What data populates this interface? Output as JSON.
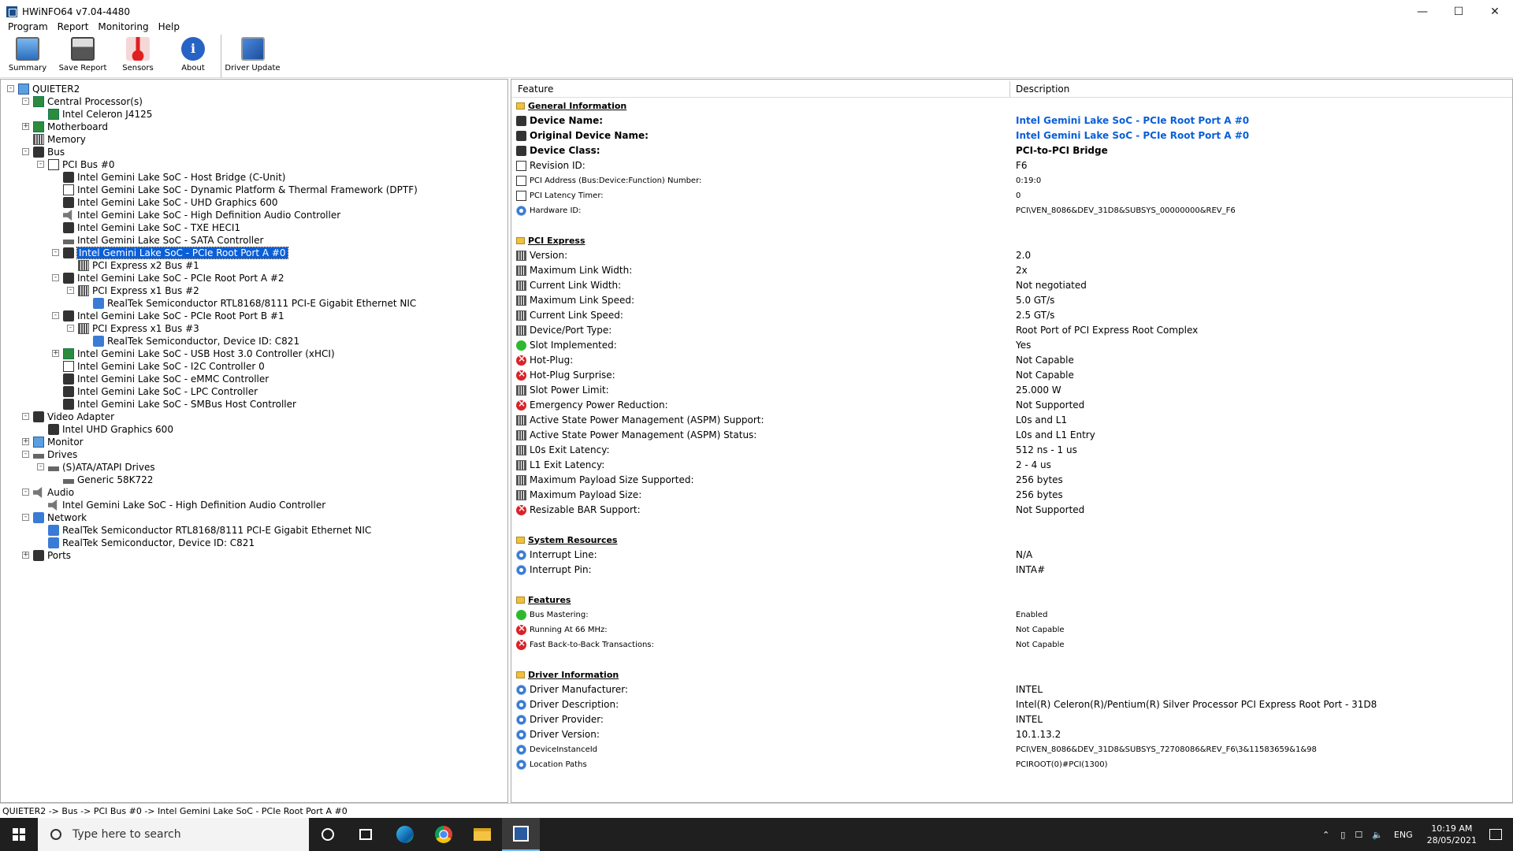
{
  "window": {
    "title": "HWiNFO64 v7.04-4480"
  },
  "menu": [
    "Program",
    "Report",
    "Monitoring",
    "Help"
  ],
  "toolbar": [
    {
      "label": "Summary",
      "icon": "monitor-icon"
    },
    {
      "label": "Save Report",
      "icon": "floppy-icon"
    },
    {
      "label": "Sensors",
      "icon": "thermometer-icon"
    },
    {
      "label": "About",
      "icon": "info-icon"
    },
    {
      "label": "Driver Update",
      "icon": "driver-update-icon"
    }
  ],
  "tree": [
    {
      "label": "QUIETER2",
      "level": 0,
      "exp": "-",
      "icon": "computer"
    },
    {
      "label": "Central Processor(s)",
      "level": 1,
      "exp": "-",
      "icon": "green"
    },
    {
      "label": "Intel Celeron J4125",
      "level": 2,
      "exp": "",
      "icon": "green"
    },
    {
      "label": "Motherboard",
      "level": 1,
      "exp": "+",
      "icon": "green"
    },
    {
      "label": "Memory",
      "level": 1,
      "exp": "",
      "icon": "grid"
    },
    {
      "label": "Bus",
      "level": 1,
      "exp": "-",
      "icon": "bus"
    },
    {
      "label": "PCI Bus #0",
      "level": 2,
      "exp": "-",
      "icon": "pci"
    },
    {
      "label": "Intel Gemini Lake SoC - Host Bridge (C-Unit)",
      "level": 3,
      "exp": "",
      "icon": "chip"
    },
    {
      "label": "Intel Gemini Lake SoC - Dynamic Platform & Thermal Framework (DPTF)",
      "level": 3,
      "exp": "",
      "icon": "pci"
    },
    {
      "label": "Intel Gemini Lake SoC - UHD Graphics 600",
      "level": 3,
      "exp": "",
      "icon": "gpu"
    },
    {
      "label": "Intel Gemini Lake SoC - High Definition Audio Controller",
      "level": 3,
      "exp": "",
      "icon": "speaker"
    },
    {
      "label": "Intel Gemini Lake SoC - TXE HECI1",
      "level": 3,
      "exp": "",
      "icon": "chip"
    },
    {
      "label": "Intel Gemini Lake SoC - SATA Controller",
      "level": 3,
      "exp": "",
      "icon": "drive"
    },
    {
      "label": "Intel Gemini Lake SoC - PCIe Root Port A #0",
      "level": 3,
      "exp": "-",
      "icon": "chip",
      "selected": true
    },
    {
      "label": "PCI Express x2 Bus #1",
      "level": 4,
      "exp": "",
      "icon": "grid"
    },
    {
      "label": "Intel Gemini Lake SoC - PCIe Root Port A #2",
      "level": 3,
      "exp": "-",
      "icon": "chip"
    },
    {
      "label": "PCI Express x1 Bus #2",
      "level": 4,
      "exp": "-",
      "icon": "grid"
    },
    {
      "label": "RealTek Semiconductor RTL8168/8111 PCI-E Gigabit Ethernet NIC",
      "level": 5,
      "exp": "",
      "icon": "net"
    },
    {
      "label": "Intel Gemini Lake SoC - PCIe Root Port B #1",
      "level": 3,
      "exp": "-",
      "icon": "chip"
    },
    {
      "label": "PCI Express x1 Bus #3",
      "level": 4,
      "exp": "-",
      "icon": "grid"
    },
    {
      "label": "RealTek Semiconductor, Device ID: C821",
      "level": 5,
      "exp": "",
      "icon": "net"
    },
    {
      "label": "Intel Gemini Lake SoC - USB Host 3.0 Controller (xHCI)",
      "level": 3,
      "exp": "+",
      "icon": "usb"
    },
    {
      "label": "Intel Gemini Lake SoC - I2C Controller 0",
      "level": 3,
      "exp": "",
      "icon": "pci"
    },
    {
      "label": "Intel Gemini Lake SoC - eMMC Controller",
      "level": 3,
      "exp": "",
      "icon": "chip"
    },
    {
      "label": "Intel Gemini Lake SoC - LPC Controller",
      "level": 3,
      "exp": "",
      "icon": "chip"
    },
    {
      "label": "Intel Gemini Lake SoC - SMBus Host Controller",
      "level": 3,
      "exp": "",
      "icon": "bus"
    },
    {
      "label": "Video Adapter",
      "level": 1,
      "exp": "-",
      "icon": "gpu"
    },
    {
      "label": "Intel UHD Graphics 600",
      "level": 2,
      "exp": "",
      "icon": "gpu"
    },
    {
      "label": "Monitor",
      "level": 1,
      "exp": "+",
      "icon": "monitor"
    },
    {
      "label": "Drives",
      "level": 1,
      "exp": "-",
      "icon": "drive"
    },
    {
      "label": "(S)ATA/ATAPI Drives",
      "level": 2,
      "exp": "-",
      "icon": "drive"
    },
    {
      "label": "Generic 58K722",
      "level": 3,
      "exp": "",
      "icon": "drive"
    },
    {
      "label": "Audio",
      "level": 1,
      "exp": "-",
      "icon": "speaker"
    },
    {
      "label": "Intel Gemini Lake SoC - High Definition Audio Controller",
      "level": 2,
      "exp": "",
      "icon": "speaker"
    },
    {
      "label": "Network",
      "level": 1,
      "exp": "-",
      "icon": "net"
    },
    {
      "label": "RealTek Semiconductor RTL8168/8111 PCI-E Gigabit Ethernet NIC",
      "level": 2,
      "exp": "",
      "icon": "net"
    },
    {
      "label": "RealTek Semiconductor, Device ID: C821",
      "level": 2,
      "exp": "",
      "icon": "net"
    },
    {
      "label": "Ports",
      "level": 1,
      "exp": "+",
      "icon": "port"
    }
  ],
  "details": {
    "headers": {
      "feature": "Feature",
      "description": "Description"
    },
    "rows": [
      {
        "type": "section",
        "feature": "General Information"
      },
      {
        "icon": "chip",
        "feature": "Device Name:",
        "value": "Intel Gemini Lake SoC - PCIe Root Port A #0",
        "fstyle": "bold",
        "vstyle": "blue"
      },
      {
        "icon": "chip",
        "feature": "Original Device Name:",
        "value": "Intel Gemini Lake SoC - PCIe Root Port A #0",
        "fstyle": "bold",
        "vstyle": "blue"
      },
      {
        "icon": "chip",
        "feature": "Device Class:",
        "value": "PCI-to-PCI Bridge",
        "fstyle": "bold",
        "vstyle": "bold"
      },
      {
        "icon": "pci",
        "feature": "Revision ID:",
        "value": "F6"
      },
      {
        "icon": "pci",
        "feature": "PCI Address (Bus:Device:Function) Number:",
        "value": "0:19:0",
        "fstyle": "small",
        "vstyle": "small"
      },
      {
        "icon": "pci",
        "feature": "PCI Latency Timer:",
        "value": "0",
        "fstyle": "small",
        "vstyle": "small"
      },
      {
        "icon": "gear",
        "feature": "Hardware ID:",
        "value": "PCI\\VEN_8086&DEV_31D8&SUBSYS_00000000&REV_F6",
        "fstyle": "small",
        "vstyle": "small"
      },
      {
        "type": "blank"
      },
      {
        "type": "section",
        "feature": "PCI Express"
      },
      {
        "icon": "grid",
        "feature": "Version:",
        "value": "2.0"
      },
      {
        "icon": "grid",
        "feature": "Maximum Link Width:",
        "value": "2x"
      },
      {
        "icon": "grid",
        "feature": "Current Link Width:",
        "value": "Not negotiated"
      },
      {
        "icon": "grid",
        "feature": "Maximum Link Speed:",
        "value": "5.0 GT/s"
      },
      {
        "icon": "grid",
        "feature": "Current Link Speed:",
        "value": "2.5 GT/s"
      },
      {
        "icon": "grid",
        "feature": "Device/Port Type:",
        "value": "Root Port of PCI Express Root Complex"
      },
      {
        "icon": "ok",
        "feature": "Slot Implemented:",
        "value": "Yes"
      },
      {
        "icon": "no",
        "feature": "Hot-Plug:",
        "value": "Not Capable"
      },
      {
        "icon": "no",
        "feature": "Hot-Plug Surprise:",
        "value": "Not Capable"
      },
      {
        "icon": "grid",
        "feature": "Slot Power Limit:",
        "value": "25.000 W"
      },
      {
        "icon": "no",
        "feature": "Emergency Power Reduction:",
        "value": "Not Supported"
      },
      {
        "icon": "grid",
        "feature": "Active State Power Management (ASPM) Support:",
        "value": "L0s and L1"
      },
      {
        "icon": "grid",
        "feature": "Active State Power Management (ASPM) Status:",
        "value": "L0s and L1 Entry"
      },
      {
        "icon": "grid",
        "feature": "L0s Exit Latency:",
        "value": "512 ns - 1 us"
      },
      {
        "icon": "grid",
        "feature": "L1 Exit Latency:",
        "value": "2 - 4 us"
      },
      {
        "icon": "grid",
        "feature": "Maximum Payload Size Supported:",
        "value": "256 bytes"
      },
      {
        "icon": "grid",
        "feature": "Maximum Payload Size:",
        "value": "256 bytes"
      },
      {
        "icon": "no",
        "feature": "Resizable BAR Support:",
        "value": "Not Supported"
      },
      {
        "type": "blank"
      },
      {
        "type": "section",
        "feature": "System Resources"
      },
      {
        "icon": "gear",
        "feature": "Interrupt Line:",
        "value": "N/A"
      },
      {
        "icon": "gear",
        "feature": "Interrupt Pin:",
        "value": "INTA#"
      },
      {
        "type": "blank"
      },
      {
        "type": "section",
        "feature": "Features"
      },
      {
        "icon": "ok",
        "feature": "Bus Mastering:",
        "value": "Enabled",
        "fstyle": "small",
        "vstyle": "small"
      },
      {
        "icon": "no",
        "feature": "Running At 66 MHz:",
        "value": "Not Capable",
        "fstyle": "small",
        "vstyle": "small"
      },
      {
        "icon": "no",
        "feature": "Fast Back-to-Back Transactions:",
        "value": "Not Capable",
        "fstyle": "small",
        "vstyle": "small"
      },
      {
        "type": "blank"
      },
      {
        "type": "section",
        "feature": "Driver Information"
      },
      {
        "icon": "gear",
        "feature": "Driver Manufacturer:",
        "value": "INTEL"
      },
      {
        "icon": "gear",
        "feature": "Driver Description:",
        "value": "Intel(R) Celeron(R)/Pentium(R) Silver Processor PCI Express Root Port - 31D8"
      },
      {
        "icon": "gear",
        "feature": "Driver Provider:",
        "value": "INTEL"
      },
      {
        "icon": "gear",
        "feature": "Driver Version:",
        "value": "10.1.13.2"
      },
      {
        "icon": "gear",
        "feature": "DeviceInstanceId",
        "value": "PCI\\VEN_8086&DEV_31D8&SUBSYS_72708086&REV_F6\\3&11583659&1&98",
        "fstyle": "small",
        "vstyle": "small"
      },
      {
        "icon": "gear",
        "feature": "Location Paths",
        "value": "PCIROOT(0)#PCI(1300)",
        "fstyle": "small",
        "vstyle": "small"
      }
    ]
  },
  "statusbar": "QUIETER2 -> Bus -> PCI Bus #0 -> Intel Gemini Lake SoC - PCIe Root Port A #0",
  "taskbar": {
    "search_placeholder": "Type here to search",
    "apps": [
      "cortana-icon",
      "task-view-icon",
      "edge-icon",
      "chrome-icon",
      "file-explorer-icon",
      "hwinfo-icon"
    ],
    "lang": "ENG",
    "time": "10:19 AM",
    "date": "28/05/2021"
  }
}
